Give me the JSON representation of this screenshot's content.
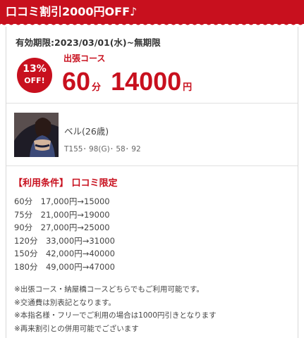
{
  "banner": {
    "title": "口コミ割引2000円OFF♪"
  },
  "coupon": {
    "validity": "有効期限:2023/03/01(水)~無期限",
    "discount_percent": "13%",
    "discount_off": "OFF!",
    "course_label": "出張コース",
    "minutes": "60",
    "minutes_unit": "分",
    "price": "14000",
    "price_unit": "円"
  },
  "girl": {
    "name": "ベル(26歳)",
    "stats": "T155･ 98(G)･ 58･ 92"
  },
  "conditions": {
    "heading": "【利用条件】 口コミ限定",
    "prices": [
      "60分　17,000円→15000",
      "75分　21,000円→19000",
      "90分　27,000円→25000",
      "120分　33,000円→31000",
      "150分　42,000円→40000",
      "180分　49,000円→47000"
    ],
    "notes": [
      "※出張コース・納屋橋コースどちらでもご利用可能です。",
      "※交通費は別表記となります。",
      "※本指名様・フリーでご利用の場合は1000円引きとなります",
      "※再来割引との併用可能でございます"
    ]
  },
  "colors": {
    "accent": "#c8101e"
  }
}
